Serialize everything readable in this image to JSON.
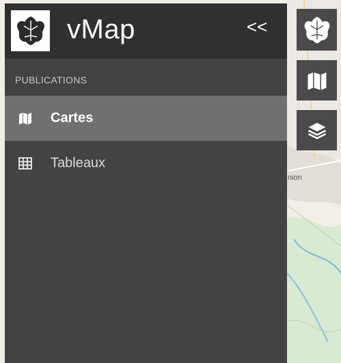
{
  "app": {
    "title": "vMap"
  },
  "sidebar": {
    "collapse_label": "<<",
    "section_title": "PUBLICATIONS",
    "items": [
      {
        "label": "Cartes",
        "icon": "map-icon",
        "active": true
      },
      {
        "label": "Tableaux",
        "icon": "table-grid-icon",
        "active": false
      }
    ]
  },
  "map": {
    "visible_place_label": "nion",
    "buttons": [
      {
        "icon": "vine-leaf-icon"
      },
      {
        "icon": "map-icon"
      },
      {
        "icon": "layers-icon"
      }
    ]
  },
  "colors": {
    "header_bg": "#303030",
    "sidebar_bg": "#434343",
    "active_item_bg": "#707070",
    "map_button_bg": "#4a4a4a"
  }
}
